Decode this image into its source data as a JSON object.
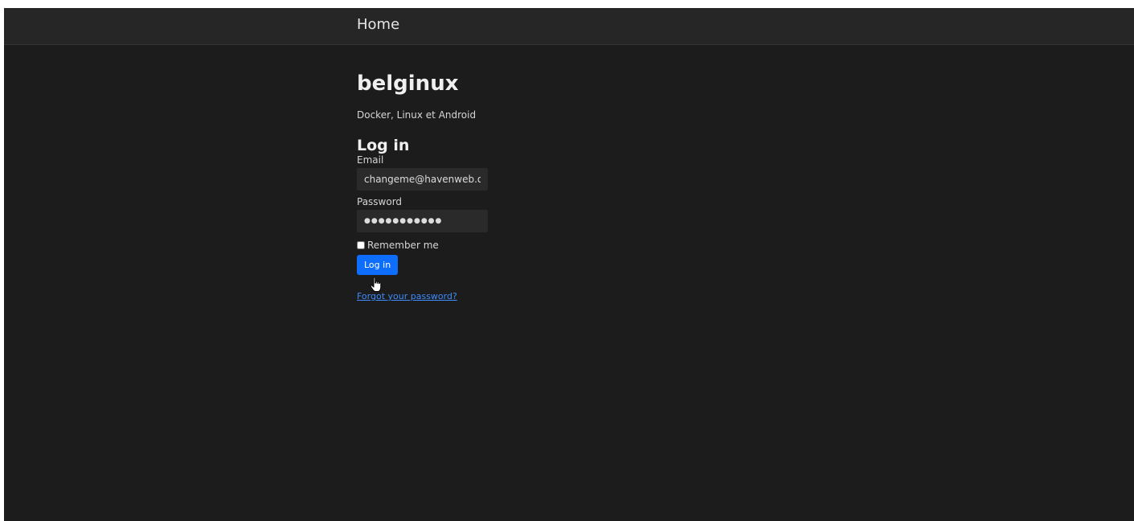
{
  "nav": {
    "home_label": "Home"
  },
  "site": {
    "title": "belginux",
    "description": "Docker, Linux et Android"
  },
  "login_form": {
    "heading": "Log in",
    "email_label": "Email",
    "email_value": "changeme@havenweb.org",
    "password_label": "Password",
    "password_value": "●●●●●●●●●●●",
    "remember_label": "Remember me",
    "remember_checked": false,
    "submit_label": "Log in",
    "forgot_link": "Forgot your password?"
  },
  "colors": {
    "background": "#1c1c1c",
    "topbar": "#262626",
    "accent": "#0d6efd",
    "link": "#3d8bfd"
  },
  "icons": {
    "cursor": "hand-pointer-icon"
  }
}
